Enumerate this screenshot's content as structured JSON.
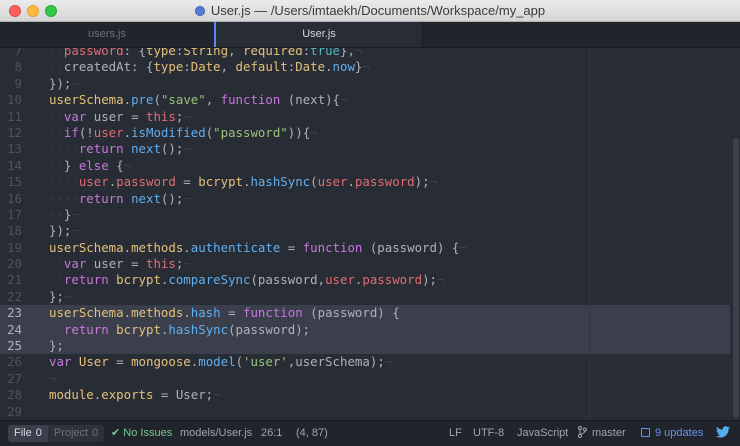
{
  "window": {
    "title": "User.js — /Users/imtaekh/Documents/Workspace/my_app"
  },
  "tabs": [
    {
      "label": "users.js",
      "active": false
    },
    {
      "label": "User.js",
      "active": true
    }
  ],
  "editor": {
    "lines": [
      {
        "num": "7",
        "tokens": [
          [
            "indent",
            "··"
          ],
          [
            "v",
            "password"
          ],
          [
            "p",
            ": {"
          ],
          [
            "c",
            "type"
          ],
          [
            "p",
            ":"
          ],
          [
            "c",
            "String"
          ],
          [
            "p",
            ", "
          ],
          [
            "c",
            "required"
          ],
          [
            "p",
            ":"
          ],
          [
            "o",
            "true"
          ],
          [
            "p",
            "},"
          ],
          [
            "inv",
            "¬"
          ]
        ]
      },
      {
        "num": "8",
        "tokens": [
          [
            "indent",
            "··"
          ],
          [
            "p",
            "createdAt: {"
          ],
          [
            "c",
            "type"
          ],
          [
            "p",
            ":"
          ],
          [
            "c",
            "Date"
          ],
          [
            "p",
            ", "
          ],
          [
            "c",
            "default"
          ],
          [
            "p",
            ":"
          ],
          [
            "c",
            "Date"
          ],
          [
            "p",
            "."
          ],
          [
            "f",
            "now"
          ],
          [
            "p",
            "}"
          ],
          [
            "inv",
            "¬"
          ]
        ]
      },
      {
        "num": "9",
        "tokens": [
          [
            "p",
            "});"
          ],
          [
            "inv",
            "¬"
          ]
        ]
      },
      {
        "num": "10",
        "tokens": [
          [
            "c",
            "userSchema"
          ],
          [
            "p",
            "."
          ],
          [
            "f",
            "pre"
          ],
          [
            "p",
            "("
          ],
          [
            "s",
            "\"save\""
          ],
          [
            "p",
            ", "
          ],
          [
            "k",
            "function"
          ],
          [
            "p",
            " (next){"
          ],
          [
            "inv",
            "¬"
          ]
        ]
      },
      {
        "num": "11",
        "tokens": [
          [
            "indent",
            "··"
          ],
          [
            "k",
            "var"
          ],
          [
            "p",
            " user = "
          ],
          [
            "v",
            "this"
          ],
          [
            "p",
            ";"
          ],
          [
            "inv",
            "¬"
          ]
        ]
      },
      {
        "num": "12",
        "tokens": [
          [
            "indent",
            "··"
          ],
          [
            "k",
            "if"
          ],
          [
            "p",
            "(!"
          ],
          [
            "v",
            "user"
          ],
          [
            "p",
            "."
          ],
          [
            "f",
            "isModified"
          ],
          [
            "p",
            "("
          ],
          [
            "s",
            "\"password\""
          ],
          [
            "p",
            "))"
          ],
          [
            "p",
            "{"
          ],
          [
            "inv",
            "¬"
          ]
        ]
      },
      {
        "num": "13",
        "tokens": [
          [
            "indent",
            "····"
          ],
          [
            "k",
            "return"
          ],
          [
            "p",
            " "
          ],
          [
            "f",
            "next"
          ],
          [
            "p",
            "();"
          ],
          [
            "inv",
            "¬"
          ]
        ]
      },
      {
        "num": "14",
        "tokens": [
          [
            "indent",
            "··"
          ],
          [
            "p",
            "} "
          ],
          [
            "k",
            "else"
          ],
          [
            "p",
            " {"
          ],
          [
            "inv",
            "¬"
          ]
        ]
      },
      {
        "num": "15",
        "tokens": [
          [
            "indent",
            "····"
          ],
          [
            "v",
            "user"
          ],
          [
            "p",
            "."
          ],
          [
            "v",
            "password"
          ],
          [
            "p",
            " = "
          ],
          [
            "c",
            "bcrypt"
          ],
          [
            "p",
            "."
          ],
          [
            "f",
            "hashSync"
          ],
          [
            "p",
            "("
          ],
          [
            "v",
            "user"
          ],
          [
            "p",
            "."
          ],
          [
            "v",
            "password"
          ],
          [
            "p",
            ");"
          ],
          [
            "inv",
            "¬"
          ]
        ]
      },
      {
        "num": "16",
        "tokens": [
          [
            "indent",
            "····"
          ],
          [
            "k",
            "return"
          ],
          [
            "p",
            " "
          ],
          [
            "f",
            "next"
          ],
          [
            "p",
            "();"
          ],
          [
            "inv",
            "¬"
          ]
        ]
      },
      {
        "num": "17",
        "tokens": [
          [
            "indent",
            "··"
          ],
          [
            "p",
            "}"
          ],
          [
            "inv",
            "¬"
          ]
        ]
      },
      {
        "num": "18",
        "tokens": [
          [
            "p",
            "});"
          ],
          [
            "inv",
            "¬"
          ]
        ]
      },
      {
        "num": "19",
        "tokens": [
          [
            "c",
            "userSchema"
          ],
          [
            "p",
            "."
          ],
          [
            "c",
            "methods"
          ],
          [
            "p",
            "."
          ],
          [
            "f",
            "authenticate"
          ],
          [
            "p",
            " = "
          ],
          [
            "k",
            "function"
          ],
          [
            "p",
            " (password) {"
          ],
          [
            "inv",
            "¬"
          ]
        ]
      },
      {
        "num": "20",
        "tokens": [
          [
            "indent",
            "··"
          ],
          [
            "k",
            "var"
          ],
          [
            "p",
            " user = "
          ],
          [
            "v",
            "this"
          ],
          [
            "p",
            ";"
          ],
          [
            "inv",
            "¬"
          ]
        ]
      },
      {
        "num": "21",
        "tokens": [
          [
            "indent",
            "··"
          ],
          [
            "k",
            "return"
          ],
          [
            "p",
            " "
          ],
          [
            "c",
            "bcrypt"
          ],
          [
            "p",
            "."
          ],
          [
            "f",
            "compareSync"
          ],
          [
            "p",
            "(password,"
          ],
          [
            "v",
            "user"
          ],
          [
            "p",
            "."
          ],
          [
            "v",
            "password"
          ],
          [
            "p",
            ");"
          ],
          [
            "inv",
            "¬"
          ]
        ]
      },
      {
        "num": "22",
        "tokens": [
          [
            "p",
            "};"
          ],
          [
            "inv",
            "¬"
          ]
        ]
      },
      {
        "num": "23",
        "highlight": true,
        "tokens": [
          [
            "c",
            "userSchema"
          ],
          [
            "p",
            "."
          ],
          [
            "c",
            "methods"
          ],
          [
            "p",
            "."
          ],
          [
            "f",
            "hash"
          ],
          [
            "p",
            " = "
          ],
          [
            "k",
            "function"
          ],
          [
            "p",
            " (password) {"
          ],
          [
            "inv",
            "¬"
          ]
        ]
      },
      {
        "num": "24",
        "highlight": true,
        "tokens": [
          [
            "indent",
            "··"
          ],
          [
            "k",
            "return"
          ],
          [
            "p",
            " "
          ],
          [
            "c",
            "bcrypt"
          ],
          [
            "p",
            "."
          ],
          [
            "f",
            "hashSync"
          ],
          [
            "p",
            "(password);"
          ],
          [
            "inv",
            "¬"
          ]
        ]
      },
      {
        "num": "25",
        "highlight": true,
        "tokens": [
          [
            "p",
            "};"
          ],
          [
            "inv",
            "¬"
          ]
        ]
      },
      {
        "num": "26",
        "tokens": [
          [
            "k",
            "var"
          ],
          [
            "p",
            " "
          ],
          [
            "c",
            "User"
          ],
          [
            "p",
            " = "
          ],
          [
            "c",
            "mongoose"
          ],
          [
            "p",
            "."
          ],
          [
            "f",
            "model"
          ],
          [
            "p",
            "("
          ],
          [
            "s",
            "'user'"
          ],
          [
            "p",
            ",userSchema);"
          ],
          [
            "inv",
            "¬"
          ]
        ]
      },
      {
        "num": "27",
        "tokens": [
          [
            "inv",
            "¬"
          ]
        ]
      },
      {
        "num": "28",
        "tokens": [
          [
            "c",
            "module"
          ],
          [
            "p",
            "."
          ],
          [
            "c",
            "exports"
          ],
          [
            "p",
            " = User;"
          ],
          [
            "inv",
            "¬"
          ]
        ]
      },
      {
        "num": "29",
        "tokens": []
      }
    ]
  },
  "status": {
    "file_label": "File",
    "file_count": "0",
    "project_label": "Project",
    "project_count": "0",
    "issues": "No Issues",
    "path": "models/User.js",
    "cursor": "26:1",
    "selection": "(4, 87)",
    "line_ending": "LF",
    "encoding": "UTF-8",
    "grammar": "JavaScript",
    "branch": "master",
    "updates": "9 updates"
  },
  "colors": {
    "accent": "#568af2",
    "editor_bg": "#282c34",
    "ok_green": "#73c990",
    "update_blue": "#6494ed"
  }
}
